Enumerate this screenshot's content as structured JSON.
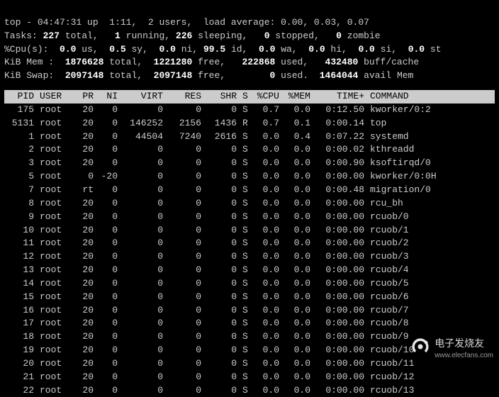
{
  "summary": {
    "line1": {
      "prefix": "top - ",
      "time": "04:47:31",
      "up": " up  1:11,  ",
      "users": "2 users,",
      "load_label": "  load average: ",
      "load": "0.00, 0.03, 0.07"
    },
    "tasks": {
      "label": "Tasks:",
      "total": "227",
      "total_l": " total,",
      "running": "1",
      "running_l": " running,",
      "sleeping": "226",
      "sleeping_l": " sleeping,",
      "stopped": "0",
      "stopped_l": " stopped,",
      "zombie": "0",
      "zombie_l": " zombie"
    },
    "cpu": {
      "label": "%Cpu(s):",
      "us": "0.0",
      "us_l": " us,",
      "sy": "0.5",
      "sy_l": " sy,",
      "ni": "0.0",
      "ni_l": " ni,",
      "id": "99.5",
      "id_l": " id,",
      "wa": "0.0",
      "wa_l": " wa,",
      "hi": "0.0",
      "hi_l": " hi,",
      "si": "0.0",
      "si_l": " si,",
      "st": "0.0",
      "st_l": " st"
    },
    "mem": {
      "label": "KiB Mem :",
      "total": "1876628",
      "total_l": " total,",
      "free": "1221280",
      "free_l": " free,",
      "used": "222868",
      "used_l": " used,",
      "buff": "432480",
      "buff_l": " buff/cache"
    },
    "swap": {
      "label": "KiB Swap:",
      "total": "2097148",
      "total_l": " total,",
      "free": "2097148",
      "free_l": " free,",
      "used": "0",
      "used_l": " used.",
      "avail": "1464044",
      "avail_l": " avail Mem"
    }
  },
  "headers": {
    "pid": "PID",
    "user": "USER",
    "pr": "PR",
    "ni": "NI",
    "virt": "VIRT",
    "res": "RES",
    "shr": "SHR",
    "s": "S",
    "cpu": "%CPU",
    "mem": "%MEM",
    "time": "TIME+",
    "cmd": "COMMAND"
  },
  "rows": [
    {
      "pid": "175",
      "user": "root",
      "pr": "20",
      "ni": "0",
      "virt": "0",
      "res": "0",
      "shr": "0",
      "s": "S",
      "cpu": "0.7",
      "mem": "0.0",
      "time": "0:12.50",
      "cmd": "kworker/0:2"
    },
    {
      "pid": "5131",
      "user": "root",
      "pr": "20",
      "ni": "0",
      "virt": "146252",
      "res": "2156",
      "shr": "1436",
      "s": "R",
      "cpu": "0.7",
      "mem": "0.1",
      "time": "0:00.14",
      "cmd": "top"
    },
    {
      "pid": "1",
      "user": "root",
      "pr": "20",
      "ni": "0",
      "virt": "44504",
      "res": "7240",
      "shr": "2616",
      "s": "S",
      "cpu": "0.0",
      "mem": "0.4",
      "time": "0:07.22",
      "cmd": "systemd"
    },
    {
      "pid": "2",
      "user": "root",
      "pr": "20",
      "ni": "0",
      "virt": "0",
      "res": "0",
      "shr": "0",
      "s": "S",
      "cpu": "0.0",
      "mem": "0.0",
      "time": "0:00.02",
      "cmd": "kthreadd"
    },
    {
      "pid": "3",
      "user": "root",
      "pr": "20",
      "ni": "0",
      "virt": "0",
      "res": "0",
      "shr": "0",
      "s": "S",
      "cpu": "0.0",
      "mem": "0.0",
      "time": "0:00.90",
      "cmd": "ksoftirqd/0"
    },
    {
      "pid": "5",
      "user": "root",
      "pr": "0",
      "ni": "-20",
      "virt": "0",
      "res": "0",
      "shr": "0",
      "s": "S",
      "cpu": "0.0",
      "mem": "0.0",
      "time": "0:00.00",
      "cmd": "kworker/0:0H"
    },
    {
      "pid": "7",
      "user": "root",
      "pr": "rt",
      "ni": "0",
      "virt": "0",
      "res": "0",
      "shr": "0",
      "s": "S",
      "cpu": "0.0",
      "mem": "0.0",
      "time": "0:00.48",
      "cmd": "migration/0"
    },
    {
      "pid": "8",
      "user": "root",
      "pr": "20",
      "ni": "0",
      "virt": "0",
      "res": "0",
      "shr": "0",
      "s": "S",
      "cpu": "0.0",
      "mem": "0.0",
      "time": "0:00.00",
      "cmd": "rcu_bh"
    },
    {
      "pid": "9",
      "user": "root",
      "pr": "20",
      "ni": "0",
      "virt": "0",
      "res": "0",
      "shr": "0",
      "s": "S",
      "cpu": "0.0",
      "mem": "0.0",
      "time": "0:00.00",
      "cmd": "rcuob/0"
    },
    {
      "pid": "10",
      "user": "root",
      "pr": "20",
      "ni": "0",
      "virt": "0",
      "res": "0",
      "shr": "0",
      "s": "S",
      "cpu": "0.0",
      "mem": "0.0",
      "time": "0:00.00",
      "cmd": "rcuob/1"
    },
    {
      "pid": "11",
      "user": "root",
      "pr": "20",
      "ni": "0",
      "virt": "0",
      "res": "0",
      "shr": "0",
      "s": "S",
      "cpu": "0.0",
      "mem": "0.0",
      "time": "0:00.00",
      "cmd": "rcuob/2"
    },
    {
      "pid": "12",
      "user": "root",
      "pr": "20",
      "ni": "0",
      "virt": "0",
      "res": "0",
      "shr": "0",
      "s": "S",
      "cpu": "0.0",
      "mem": "0.0",
      "time": "0:00.00",
      "cmd": "rcuob/3"
    },
    {
      "pid": "13",
      "user": "root",
      "pr": "20",
      "ni": "0",
      "virt": "0",
      "res": "0",
      "shr": "0",
      "s": "S",
      "cpu": "0.0",
      "mem": "0.0",
      "time": "0:00.00",
      "cmd": "rcuob/4"
    },
    {
      "pid": "14",
      "user": "root",
      "pr": "20",
      "ni": "0",
      "virt": "0",
      "res": "0",
      "shr": "0",
      "s": "S",
      "cpu": "0.0",
      "mem": "0.0",
      "time": "0:00.00",
      "cmd": "rcuob/5"
    },
    {
      "pid": "15",
      "user": "root",
      "pr": "20",
      "ni": "0",
      "virt": "0",
      "res": "0",
      "shr": "0",
      "s": "S",
      "cpu": "0.0",
      "mem": "0.0",
      "time": "0:00.00",
      "cmd": "rcuob/6"
    },
    {
      "pid": "16",
      "user": "root",
      "pr": "20",
      "ni": "0",
      "virt": "0",
      "res": "0",
      "shr": "0",
      "s": "S",
      "cpu": "0.0",
      "mem": "0.0",
      "time": "0:00.00",
      "cmd": "rcuob/7"
    },
    {
      "pid": "17",
      "user": "root",
      "pr": "20",
      "ni": "0",
      "virt": "0",
      "res": "0",
      "shr": "0",
      "s": "S",
      "cpu": "0.0",
      "mem": "0.0",
      "time": "0:00.00",
      "cmd": "rcuob/8"
    },
    {
      "pid": "18",
      "user": "root",
      "pr": "20",
      "ni": "0",
      "virt": "0",
      "res": "0",
      "shr": "0",
      "s": "S",
      "cpu": "0.0",
      "mem": "0.0",
      "time": "0:00.00",
      "cmd": "rcuob/9"
    },
    {
      "pid": "19",
      "user": "root",
      "pr": "20",
      "ni": "0",
      "virt": "0",
      "res": "0",
      "shr": "0",
      "s": "S",
      "cpu": "0.0",
      "mem": "0.0",
      "time": "0:00.00",
      "cmd": "rcuob/10"
    },
    {
      "pid": "20",
      "user": "root",
      "pr": "20",
      "ni": "0",
      "virt": "0",
      "res": "0",
      "shr": "0",
      "s": "S",
      "cpu": "0.0",
      "mem": "0.0",
      "time": "0:00.00",
      "cmd": "rcuob/11"
    },
    {
      "pid": "21",
      "user": "root",
      "pr": "20",
      "ni": "0",
      "virt": "0",
      "res": "0",
      "shr": "0",
      "s": "S",
      "cpu": "0.0",
      "mem": "0.0",
      "time": "0:00.00",
      "cmd": "rcuob/12"
    },
    {
      "pid": "22",
      "user": "root",
      "pr": "20",
      "ni": "0",
      "virt": "0",
      "res": "0",
      "shr": "0",
      "s": "S",
      "cpu": "0.0",
      "mem": "0.0",
      "time": "0:00.00",
      "cmd": "rcuob/13"
    }
  ],
  "watermark": {
    "brand": "电子发烧友",
    "url": "www.elecfans.com"
  }
}
